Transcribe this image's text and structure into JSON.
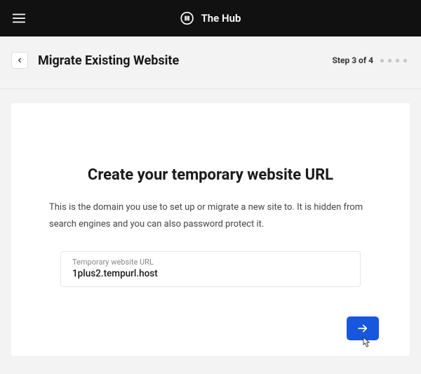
{
  "topbar": {
    "brand_name": "The Hub"
  },
  "subheader": {
    "title": "Migrate Existing Website",
    "step_text": "Step 3 of 4"
  },
  "card": {
    "title": "Create your temporary website URL",
    "description": "This is the domain you use to set up or migrate a new site to. It is hidden from search engines and you can also password protect it.",
    "input_label": "Temporary website URL",
    "input_value": "1plus2.tempurl.host"
  }
}
